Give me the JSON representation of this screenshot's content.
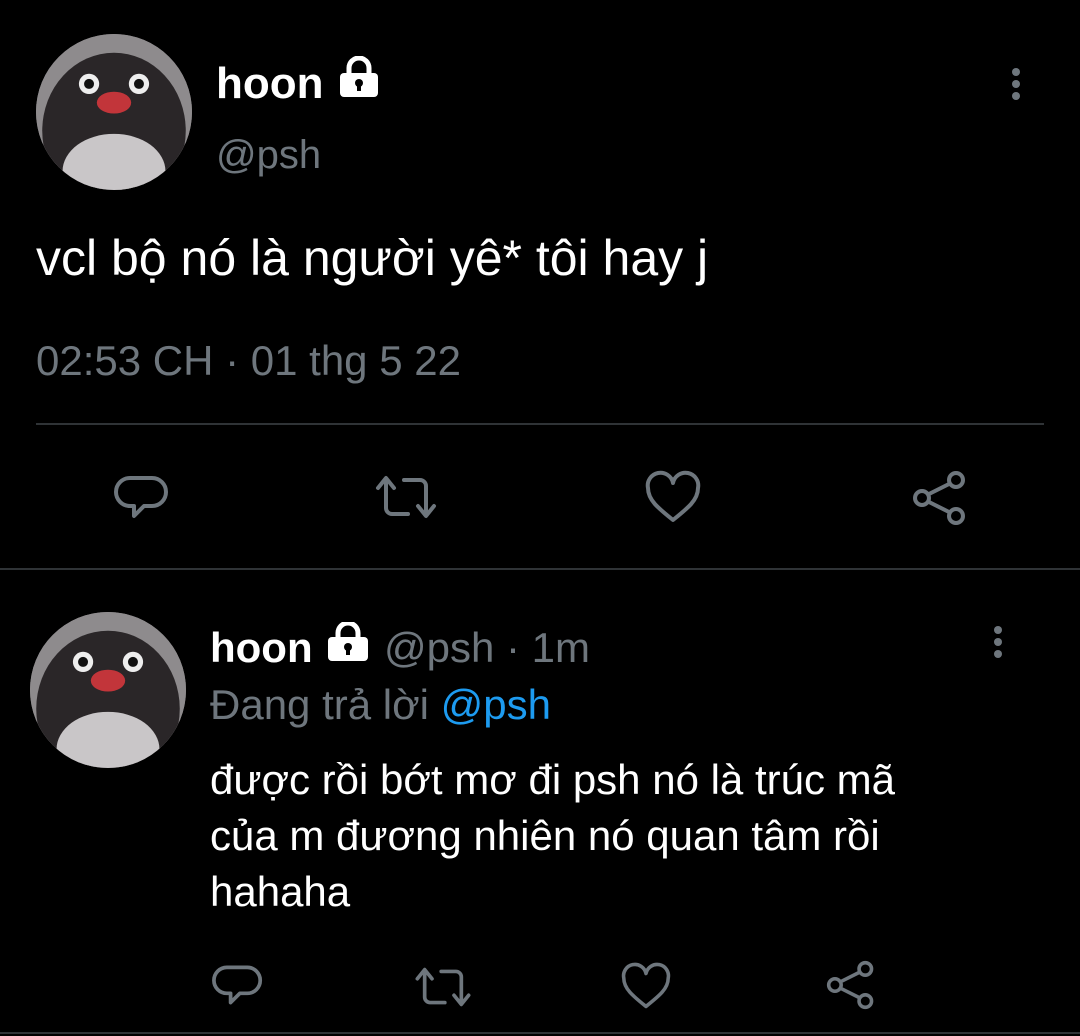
{
  "main_tweet": {
    "display_name": "hoon",
    "handle": "@psh",
    "text": "vcl bộ nó là người yê* tôi hay j",
    "timestamp": "02:53 CH · 01 thg 5 22",
    "protected_icon": "lock-icon",
    "actions": [
      "reply-icon",
      "retweet-icon",
      "like-icon",
      "share-icon"
    ]
  },
  "reply_tweet": {
    "display_name": "hoon",
    "handle": "@psh",
    "time_ago": "· 1m",
    "replying_prefix": "Đang trả lời",
    "replying_to": "@psh",
    "text_line1": "được rồi bớt mơ đi psh nó là trúc mã",
    "text_line2": "của m đương nhiên nó quan tâm rồi",
    "text_line3": "hahaha",
    "protected_icon": "lock-icon",
    "actions": [
      "reply-icon",
      "retweet-icon",
      "like-icon",
      "share-icon"
    ]
  },
  "colors": {
    "background": "#000000",
    "text_primary": "#e7e9ea",
    "text_muted": "#6e767d",
    "link": "#1d9bf0",
    "divider": "#2f3336"
  }
}
